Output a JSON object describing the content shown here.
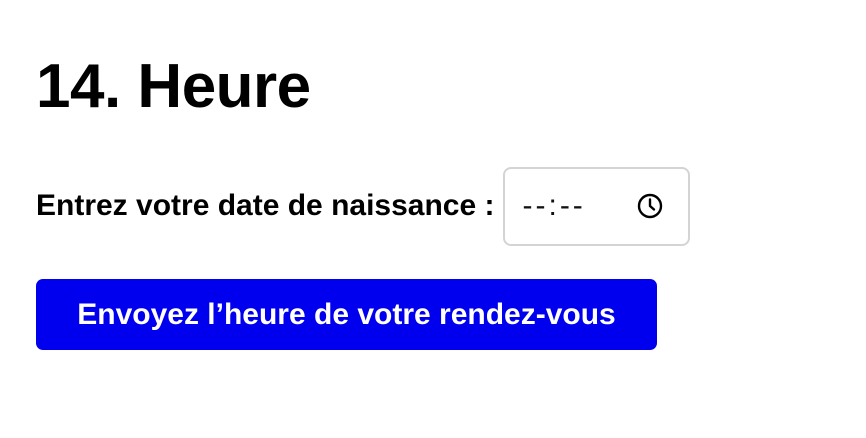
{
  "page": {
    "title": "14. Heure"
  },
  "form": {
    "label": "Entrez votre date de naissance :",
    "time_input": {
      "value": "--:--",
      "icon": "clock-icon"
    },
    "submit_label": "Envoyez l’heure de votre rendez-vous"
  },
  "colors": {
    "button_background": "#0000ee",
    "button_text": "#ffffff",
    "input_border": "#d4d4d4",
    "text": "#000000"
  }
}
